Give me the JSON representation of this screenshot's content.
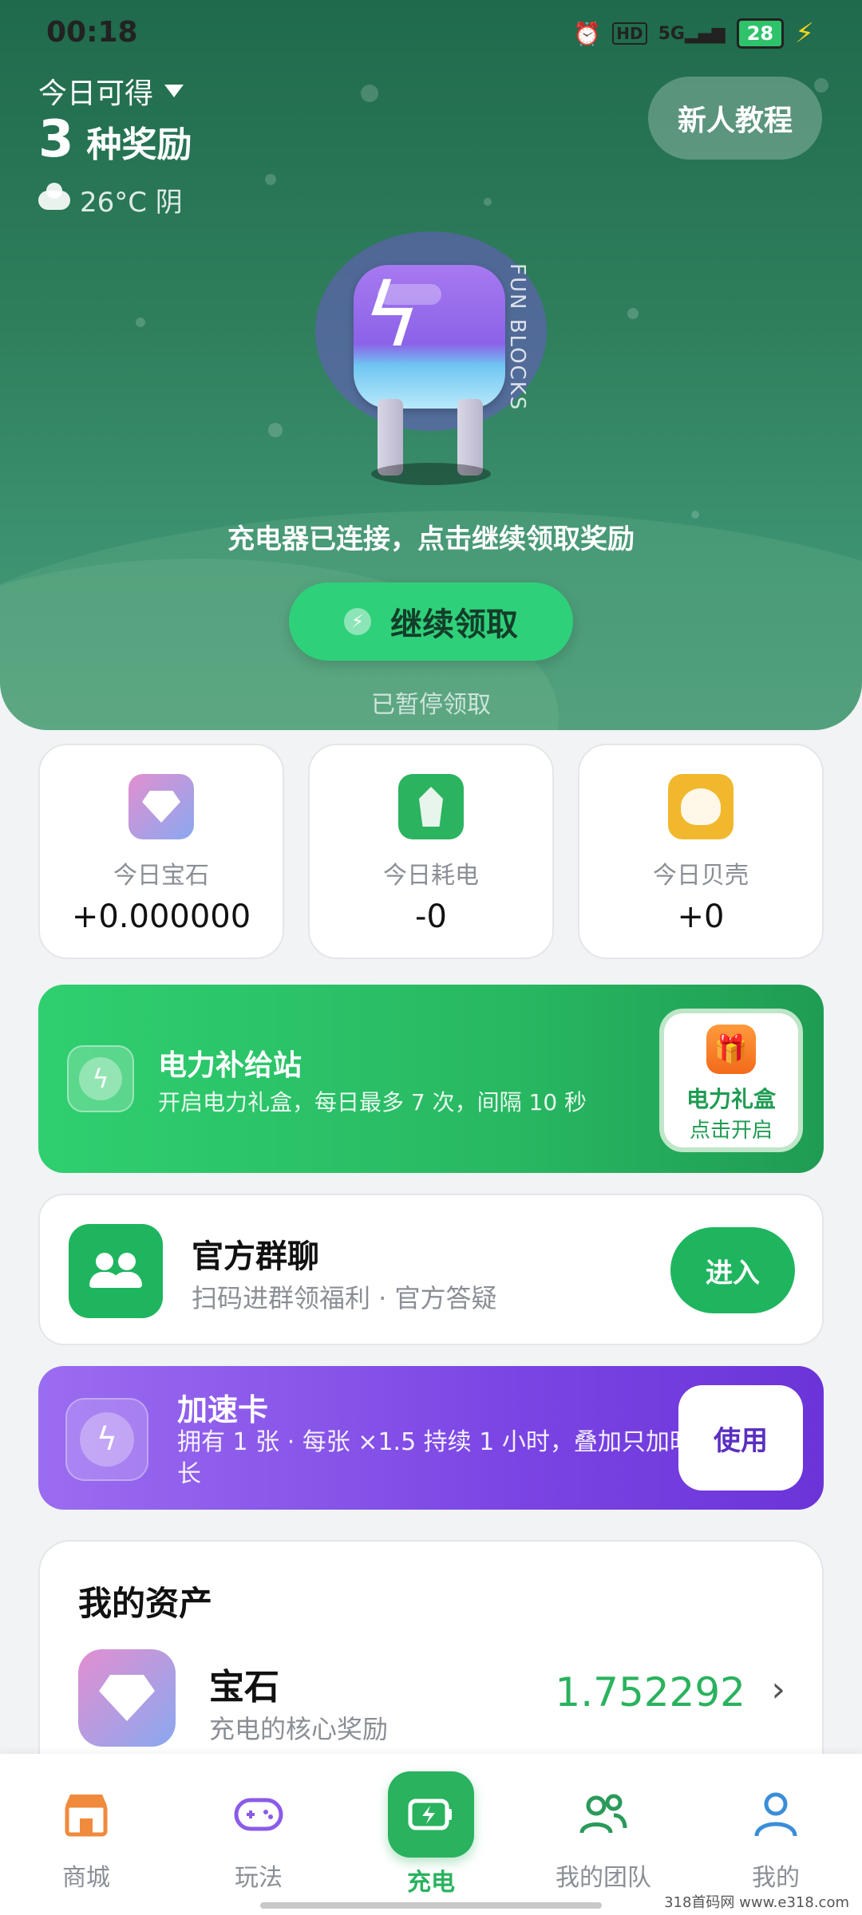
{
  "status_bar": {
    "time": "00:18",
    "battery": "28"
  },
  "header": {
    "today_label": "今日可得",
    "reward_count": "3",
    "reward_unit": "种奖励",
    "weather": "26°C 阴",
    "tutorial_button": "新人教程"
  },
  "charger": {
    "brand_text": "FUN BLOCKS",
    "connected_text": "充电器已连接，点击继续领取奖励",
    "continue_button": "继续领取",
    "paused_text": "已暂停领取"
  },
  "stats": [
    {
      "label": "今日宝石",
      "value": "+0.000000",
      "icon": "gem-icon"
    },
    {
      "label": "今日耗电",
      "value": "-0",
      "icon": "power-icon"
    },
    {
      "label": "今日贝壳",
      "value": "+0",
      "icon": "shell-icon"
    }
  ],
  "power_supply": {
    "title": "电力补给站",
    "subtitle": "开启电力礼盒，每日最多 7 次，间隔 10 秒",
    "gift_title": "电力礼盒",
    "gift_action": "点击开启"
  },
  "group_chat": {
    "title": "官方群聊",
    "subtitle": "扫码进群领福利 · 官方答疑",
    "button": "进入"
  },
  "speed_card": {
    "title": "加速卡",
    "subtitle": "拥有 1 张 · 每张 ×1.5 持续 1 小时，叠加只加时长",
    "button": "使用"
  },
  "assets": {
    "heading": "我的资产",
    "items": [
      {
        "name": "宝石",
        "desc": "充电的核心奖励",
        "amount": "1.752292"
      }
    ]
  },
  "nav": {
    "items": [
      {
        "label": "商城",
        "icon": "shop-icon"
      },
      {
        "label": "玩法",
        "icon": "gamepad-icon"
      },
      {
        "label": "充电",
        "icon": "battery-icon",
        "active": true
      },
      {
        "label": "我的团队",
        "icon": "team-icon"
      },
      {
        "label": "我的",
        "icon": "profile-icon"
      }
    ]
  },
  "watermark": "318首码网 www.e318.com",
  "colors": {
    "brand_green": "#2ab25e",
    "hero_green": "#2f7f5c",
    "speed_purple": "#7b45e4",
    "gift_orange": "#f26a1a"
  }
}
